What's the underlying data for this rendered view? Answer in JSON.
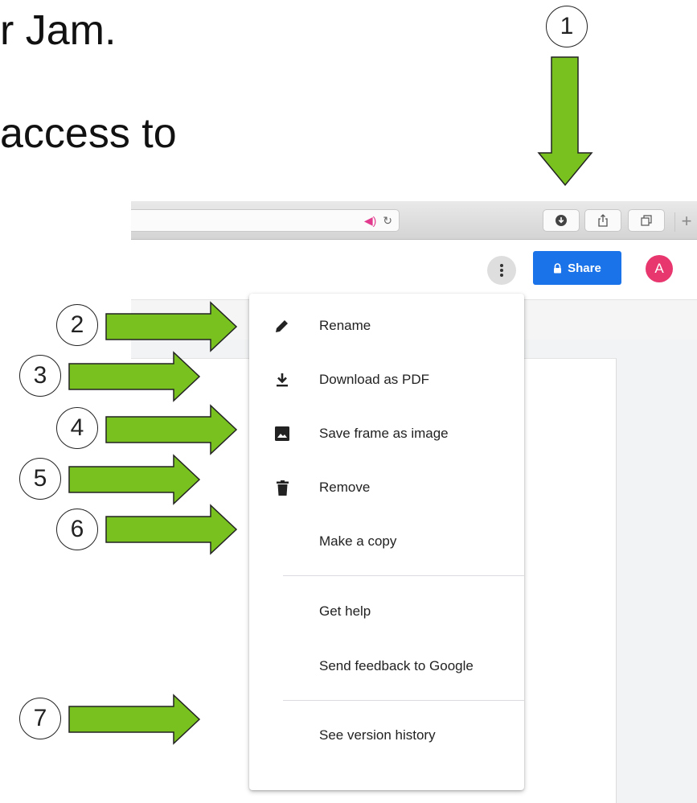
{
  "slide": {
    "line1": "r Jam.",
    "line2": "access to"
  },
  "browser": {
    "toolbar_buttons": [
      "download-icon",
      "share-sheet-icon",
      "tabs-icon"
    ],
    "new_tab": "+"
  },
  "app": {
    "share_label": "Share",
    "avatar_letter": "A",
    "colors": {
      "share_blue": "#1a73e8",
      "avatar_pink": "#e8366e",
      "arrow_green": "#78c11f"
    }
  },
  "menu": {
    "items": [
      {
        "label": "Rename",
        "icon": "pencil-icon"
      },
      {
        "label": "Download as PDF",
        "icon": "download-icon"
      },
      {
        "label": "Save frame as image",
        "icon": "image-icon"
      },
      {
        "label": "Remove",
        "icon": "trash-icon"
      },
      {
        "label": "Make a copy",
        "icon": ""
      },
      {
        "label": "Get help",
        "icon": ""
      },
      {
        "label": "Send feedback to Google",
        "icon": ""
      },
      {
        "label": "See version history",
        "icon": ""
      }
    ]
  },
  "annotations": {
    "steps": [
      "1",
      "2",
      "3",
      "4",
      "5",
      "6",
      "7"
    ]
  }
}
